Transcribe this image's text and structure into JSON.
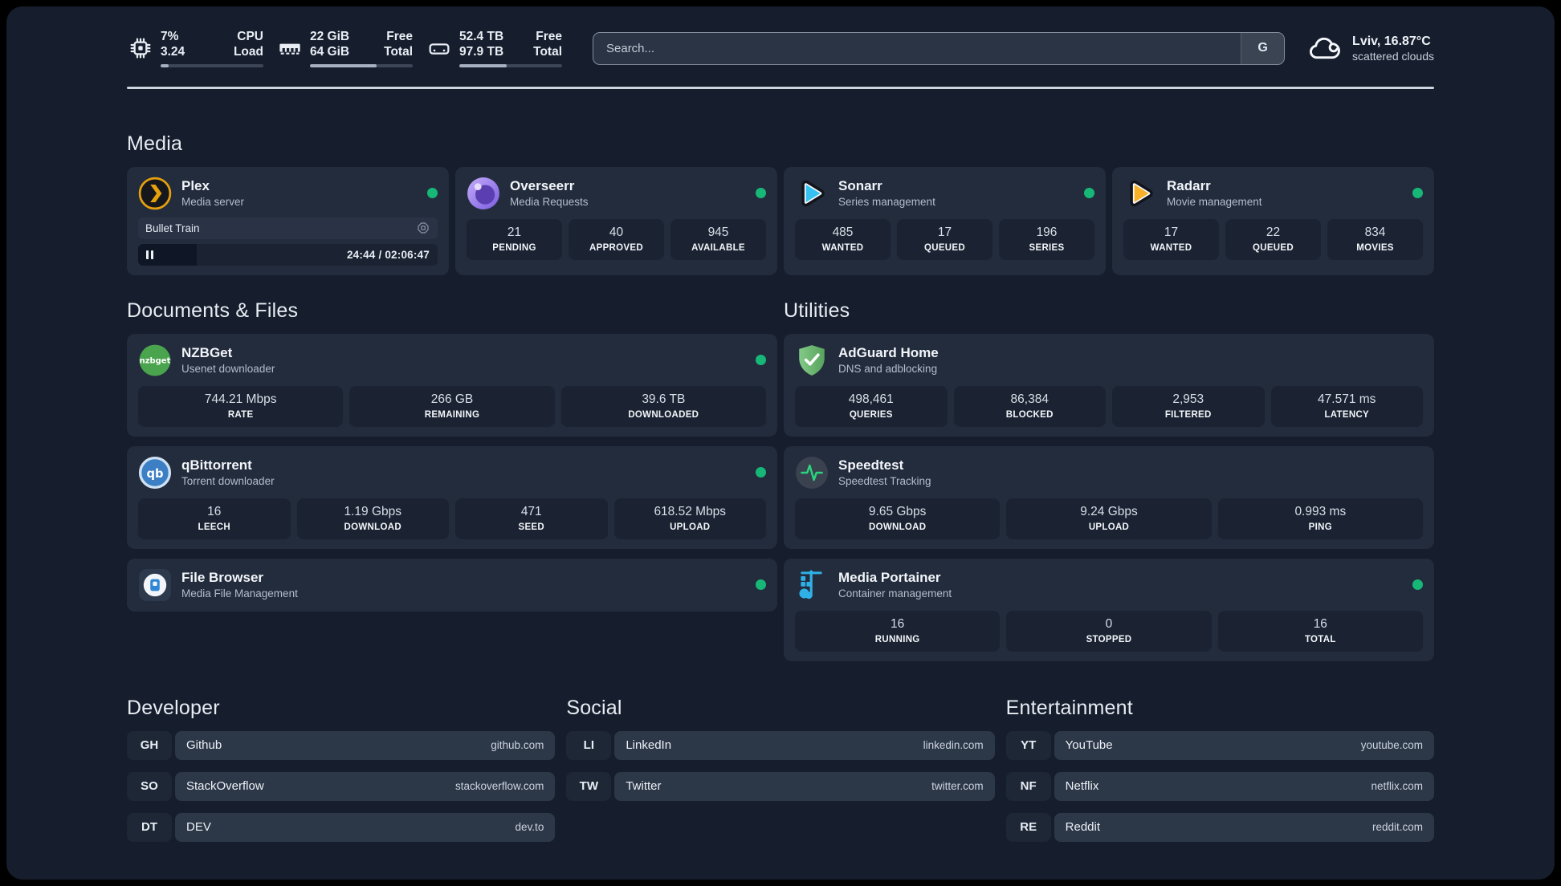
{
  "header": {
    "cpu": {
      "icon": "cpu-icon",
      "top_value": "7%",
      "top_label": "CPU",
      "bottom_value": "3.24",
      "bottom_label": "Load",
      "progress_pct": 8
    },
    "memory": {
      "icon": "memory-icon",
      "top_value": "22 GiB",
      "top_label": "Free",
      "bottom_value": "64 GiB",
      "bottom_label": "Total",
      "progress_pct": 65
    },
    "storage": {
      "icon": "storage-icon",
      "top_value": "52.4 TB",
      "top_label": "Free",
      "bottom_value": "97.9 TB",
      "bottom_label": "Total",
      "progress_pct": 46
    },
    "search": {
      "placeholder": "Search...",
      "engine_button_label": "G"
    },
    "weather": {
      "icon": "cloud-icon",
      "location_temperature": "Lviv, 16.87°C",
      "condition": "scattered clouds"
    }
  },
  "status_color": "#17b877",
  "media": {
    "title": "Media",
    "cards": [
      {
        "id": "plex",
        "icon": "plex-icon",
        "title": "Plex",
        "subtitle": "Media server",
        "status_dot": true,
        "player": {
          "title": "Bullet Train",
          "time": "24:44 / 02:06:47",
          "progress_pct": 19.5
        }
      },
      {
        "id": "overseerr",
        "icon": "overseerr-icon",
        "title": "Overseerr",
        "subtitle": "Media Requests",
        "status_dot": true,
        "stats": [
          {
            "value": "21",
            "label": "PENDING"
          },
          {
            "value": "40",
            "label": "APPROVED"
          },
          {
            "value": "945",
            "label": "AVAILABLE"
          }
        ]
      },
      {
        "id": "sonarr",
        "icon": "sonarr-icon",
        "title": "Sonarr",
        "subtitle": "Series management",
        "status_dot": true,
        "stats": [
          {
            "value": "485",
            "label": "WANTED"
          },
          {
            "value": "17",
            "label": "QUEUED"
          },
          {
            "value": "196",
            "label": "SERIES"
          }
        ]
      },
      {
        "id": "radarr",
        "icon": "radarr-icon",
        "title": "Radarr",
        "subtitle": "Movie management",
        "status_dot": true,
        "stats": [
          {
            "value": "17",
            "label": "WANTED"
          },
          {
            "value": "22",
            "label": "QUEUED"
          },
          {
            "value": "834",
            "label": "MOVIES"
          }
        ]
      }
    ]
  },
  "columns": [
    {
      "title": "Documents & Files",
      "cards": [
        {
          "id": "nzbget",
          "icon": "nzbget-icon",
          "title": "NZBGet",
          "subtitle": "Usenet downloader",
          "status_dot": true,
          "stats": [
            {
              "value": "744.21 Mbps",
              "label": "RATE"
            },
            {
              "value": "266 GB",
              "label": "REMAINING"
            },
            {
              "value": "39.6 TB",
              "label": "DOWNLOADED"
            }
          ]
        },
        {
          "id": "qbittorrent",
          "icon": "qbittorrent-icon",
          "title": "qBittorrent",
          "subtitle": "Torrent downloader",
          "status_dot": true,
          "stats": [
            {
              "value": "16",
              "label": "LEECH"
            },
            {
              "value": "1.19 Gbps",
              "label": "DOWNLOAD"
            },
            {
              "value": "471",
              "label": "SEED"
            },
            {
              "value": "618.52 Mbps",
              "label": "UPLOAD"
            }
          ]
        },
        {
          "id": "filebrowser",
          "icon": "filebrowser-icon",
          "title": "File Browser",
          "subtitle": "Media File Management",
          "status_dot": true
        }
      ]
    },
    {
      "title": "Utilities",
      "cards": [
        {
          "id": "adguard",
          "icon": "adguard-icon",
          "title": "AdGuard Home",
          "subtitle": "DNS and adblocking",
          "status_dot": false,
          "stats": [
            {
              "value": "498,461",
              "label": "QUERIES"
            },
            {
              "value": "86,384",
              "label": "BLOCKED"
            },
            {
              "value": "2,953",
              "label": "FILTERED"
            },
            {
              "value": "47.571 ms",
              "label": "LATENCY"
            }
          ]
        },
        {
          "id": "speedtest",
          "icon": "speedtest-icon",
          "title": "Speedtest",
          "subtitle": "Speedtest Tracking",
          "status_dot": false,
          "stats": [
            {
              "value": "9.65 Gbps",
              "label": "DOWNLOAD"
            },
            {
              "value": "9.24 Gbps",
              "label": "UPLOAD"
            },
            {
              "value": "0.993 ms",
              "label": "PING"
            }
          ]
        },
        {
          "id": "portainer",
          "icon": "portainer-icon",
          "title": "Media Portainer",
          "subtitle": "Container management",
          "status_dot": true,
          "stats": [
            {
              "value": "16",
              "label": "RUNNING"
            },
            {
              "value": "0",
              "label": "STOPPED"
            },
            {
              "value": "16",
              "label": "TOTAL"
            }
          ]
        }
      ]
    }
  ],
  "link_sections": [
    {
      "title": "Developer",
      "links": [
        {
          "tag": "GH",
          "name": "Github",
          "url": "github.com"
        },
        {
          "tag": "SO",
          "name": "StackOverflow",
          "url": "stackoverflow.com"
        },
        {
          "tag": "DT",
          "name": "DEV",
          "url": "dev.to"
        }
      ]
    },
    {
      "title": "Social",
      "links": [
        {
          "tag": "LI",
          "name": "LinkedIn",
          "url": "linkedin.com"
        },
        {
          "tag": "TW",
          "name": "Twitter",
          "url": "twitter.com"
        }
      ]
    },
    {
      "title": "Entertainment",
      "links": [
        {
          "tag": "YT",
          "name": "YouTube",
          "url": "youtube.com"
        },
        {
          "tag": "NF",
          "name": "Netflix",
          "url": "netflix.com"
        },
        {
          "tag": "RE",
          "name": "Reddit",
          "url": "reddit.com"
        }
      ]
    }
  ]
}
